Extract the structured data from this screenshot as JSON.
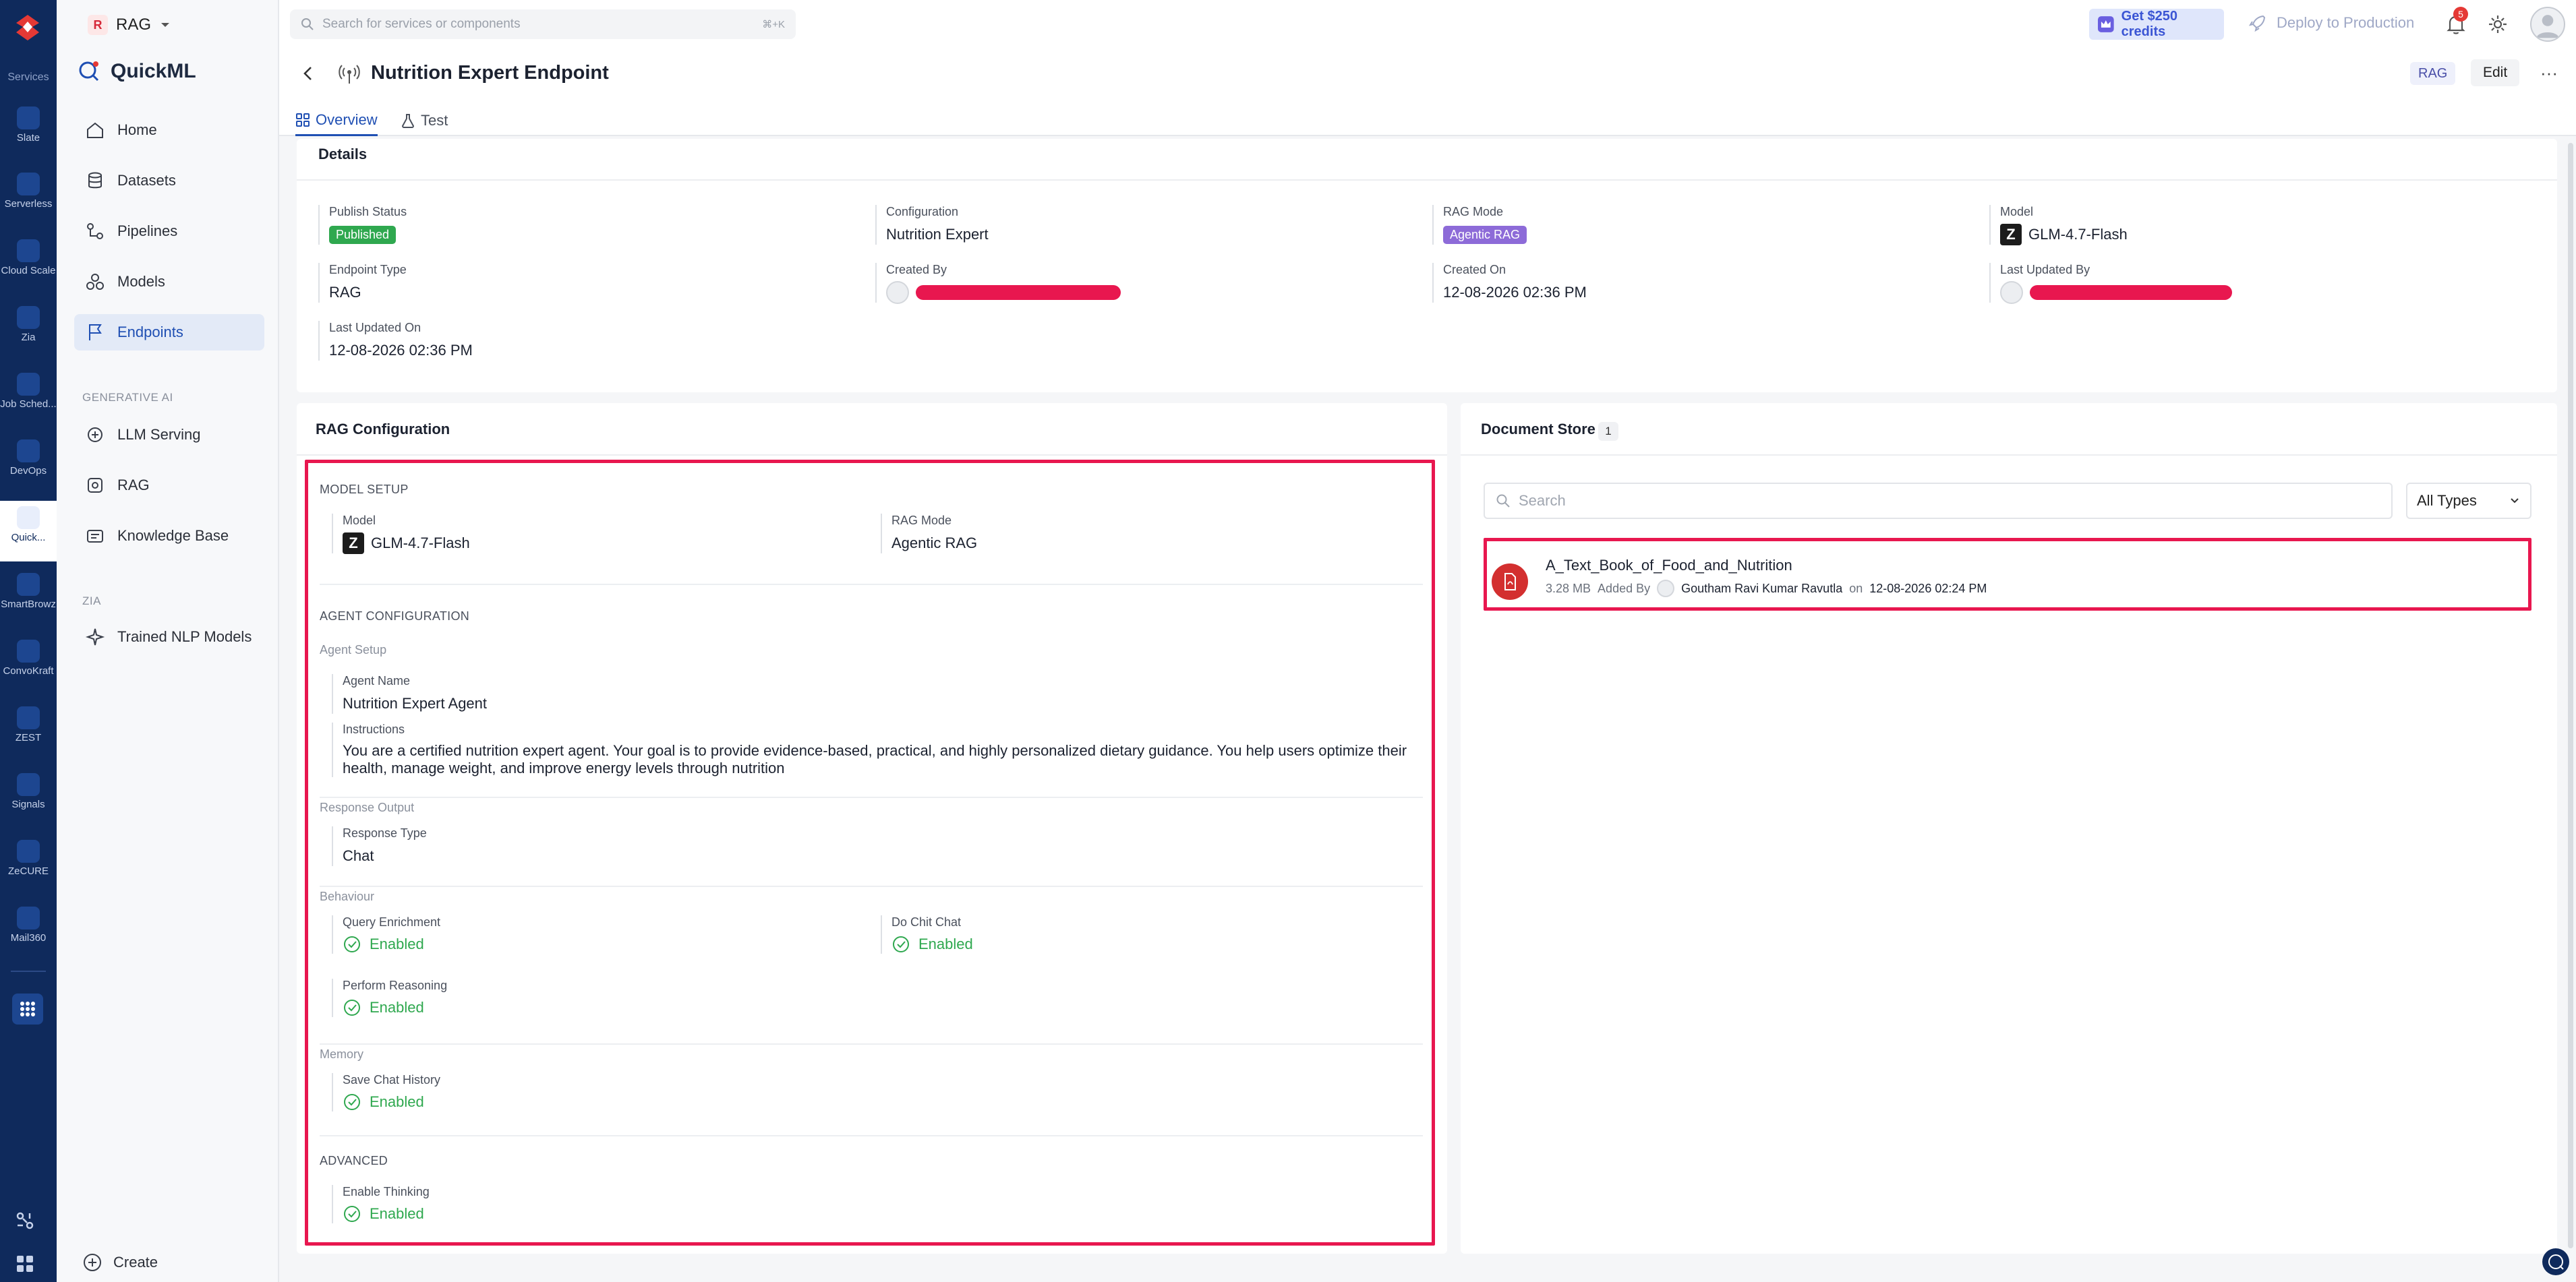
{
  "rail": {
    "section_label": "Services",
    "items": [
      {
        "label": "Slate",
        "icon": "slate-icon"
      },
      {
        "label": "Serverless",
        "icon": "serverless-icon"
      },
      {
        "label": "Cloud Scale",
        "icon": "cloud-scale-icon"
      },
      {
        "label": "Zia",
        "icon": "zia-icon"
      },
      {
        "label": "Job Sched...",
        "icon": "job-scheduler-icon"
      },
      {
        "label": "DevOps",
        "icon": "devops-icon"
      },
      {
        "label": "Quick...",
        "icon": "quickml-icon"
      },
      {
        "label": "SmartBrowz",
        "icon": "smartbrowz-icon"
      },
      {
        "label": "ConvoKraft",
        "icon": "convokraft-icon"
      },
      {
        "label": "ZEST",
        "icon": "zest-icon"
      },
      {
        "label": "Signals",
        "icon": "signals-icon"
      },
      {
        "label": "ZeCURE",
        "icon": "zecure-icon"
      },
      {
        "label": "Mail360",
        "icon": "mail360-icon"
      }
    ]
  },
  "project": {
    "badge": "R",
    "name": "RAG"
  },
  "sidenav": {
    "brand": "QuickML",
    "items": [
      {
        "label": "Home",
        "icon": "home-icon"
      },
      {
        "label": "Datasets",
        "icon": "database-icon"
      },
      {
        "label": "Pipelines",
        "icon": "pipeline-icon"
      },
      {
        "label": "Models",
        "icon": "models-icon"
      },
      {
        "label": "Endpoints",
        "icon": "flag-icon"
      }
    ],
    "genai_section": "GENERATIVE AI",
    "genai_items": [
      {
        "label": "LLM Serving",
        "icon": "llm-serving-icon"
      },
      {
        "label": "RAG",
        "icon": "rag-icon"
      },
      {
        "label": "Knowledge Base",
        "icon": "knowledge-base-icon"
      }
    ],
    "zia_section": "ZIA",
    "zia_items": [
      {
        "label": "Trained NLP Models",
        "icon": "nlp-icon"
      }
    ],
    "create_label": "Create"
  },
  "topbar": {
    "search_placeholder": "Search for services or components",
    "search_shortcut": "⌘+K",
    "credits_label": "Get $250 credits",
    "deploy_label": "Deploy to Production",
    "notification_count": "5"
  },
  "page": {
    "title": "Nutrition Expert Endpoint",
    "type_badge": "RAG",
    "edit_label": "Edit",
    "more_label": "···",
    "tabs": [
      {
        "label": "Overview"
      },
      {
        "label": "Test"
      }
    ]
  },
  "details": {
    "title": "Details",
    "publish_status_label": "Publish Status",
    "publish_status": "Published",
    "configuration_label": "Configuration",
    "configuration": "Nutrition Expert",
    "rag_mode_label": "RAG Mode",
    "rag_mode": "Agentic RAG",
    "model_label": "Model",
    "model": "GLM-4.7-Flash",
    "endpoint_type_label": "Endpoint Type",
    "endpoint_type": "RAG",
    "created_by_label": "Created By",
    "created_on_label": "Created On",
    "created_on": "12-08-2026 02:36 PM",
    "last_updated_by_label": "Last Updated By",
    "last_updated_on_label": "Last Updated On",
    "last_updated_on": "12-08-2026 02:36 PM"
  },
  "rag_config": {
    "title": "RAG Configuration",
    "model_setup_heading": "MODEL SETUP",
    "model_label": "Model",
    "model": "GLM-4.7-Flash",
    "rag_mode_label": "RAG Mode",
    "rag_mode": "Agentic RAG",
    "agent_config_heading": "AGENT CONFIGURATION",
    "agent_setup_heading": "Agent Setup",
    "agent_name_label": "Agent Name",
    "agent_name": "Nutrition Expert Agent",
    "instructions_label": "Instructions",
    "instructions": "You are a certified nutrition expert agent. Your goal is to provide evidence-based, practical, and highly personalized dietary guidance. You help users optimize their health, manage weight, and improve energy levels through nutrition",
    "response_output_heading": "Response Output",
    "response_type_label": "Response Type",
    "response_type": "Chat",
    "behaviour_heading": "Behaviour",
    "query_enrichment_label": "Query Enrichment",
    "query_enrichment": "Enabled",
    "do_chit_chat_label": "Do Chit Chat",
    "do_chit_chat": "Enabled",
    "perform_reasoning_label": "Perform Reasoning",
    "perform_reasoning": "Enabled",
    "memory_heading": "Memory",
    "save_chat_history_label": "Save Chat History",
    "save_chat_history": "Enabled",
    "advanced_heading": "ADVANCED",
    "enable_thinking_label": "Enable Thinking",
    "enable_thinking": "Enabled"
  },
  "doc_store": {
    "title": "Document Store",
    "count": "1",
    "search_placeholder": "Search",
    "type_filter": "All Types",
    "documents": [
      {
        "name": "A_Text_Book_of_Food_and_Nutrition",
        "size": "3.28 MB",
        "added_by_label": "Added By",
        "user": "Goutham Ravi Kumar Ravutla",
        "on_label": "on",
        "date": "12-08-2026 02:24 PM"
      }
    ]
  },
  "colors": {
    "rail_bg": "#0f2a5c",
    "accent": "#1f4fb3",
    "success": "#2fa84f",
    "highlight": "#e8174f",
    "agentic_pill": "#8d6bd8"
  }
}
